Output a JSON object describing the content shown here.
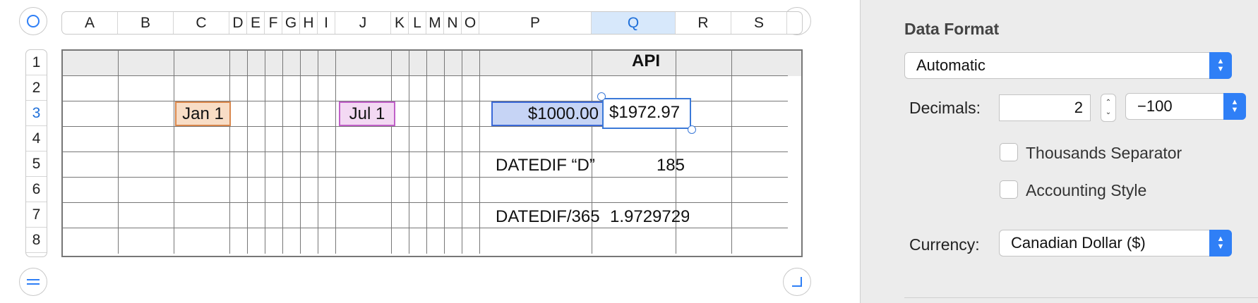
{
  "sheet": {
    "columns": [
      "A",
      "B",
      "C",
      "D",
      "E",
      "F",
      "G",
      "H",
      "I",
      "J",
      "K",
      "L",
      "M",
      "N",
      "O",
      "P",
      "Q",
      "R",
      "S"
    ],
    "selected_column": "Q",
    "rows": [
      "1",
      "2",
      "3",
      "4",
      "5",
      "6",
      "7",
      "8"
    ],
    "selected_row": "3",
    "cells": {
      "q1": "API",
      "c3": "Jan 1",
      "j3": "Jul 1",
      "p3": "$1000.00",
      "q3": "$1972.97",
      "p5": "DATEDIF “D”",
      "q5": "185",
      "p7": "DATEDIF/365",
      "q7": "1.972972972"
    },
    "colors": {
      "selection_blue": "#1e6fd9",
      "c3_fill": "#f8ddc6",
      "c3_border": "#d9874c",
      "j3_fill": "#f3d9f3",
      "j3_border": "#c060c8",
      "p3_fill": "#c6d4f5",
      "p3_border": "#3b69d8",
      "header_row_fill": "#ebebeb"
    },
    "icons": {
      "top_left": "circle-select-icon",
      "top_right": "pause-bars-icon",
      "bottom_left": "equals-icon",
      "bottom_right": "corner-resize-icon"
    }
  },
  "panel": {
    "section_title": "Data Format",
    "format_value": "Automatic",
    "decimals_label": "Decimals:",
    "decimals_value": "2",
    "negative_format": "−100",
    "thousands_label": "Thousands Separator",
    "accounting_label": "Accounting Style",
    "currency_label": "Currency:",
    "currency_value": "Canadian Dollar ($)",
    "accent": "#2f7ff6"
  }
}
